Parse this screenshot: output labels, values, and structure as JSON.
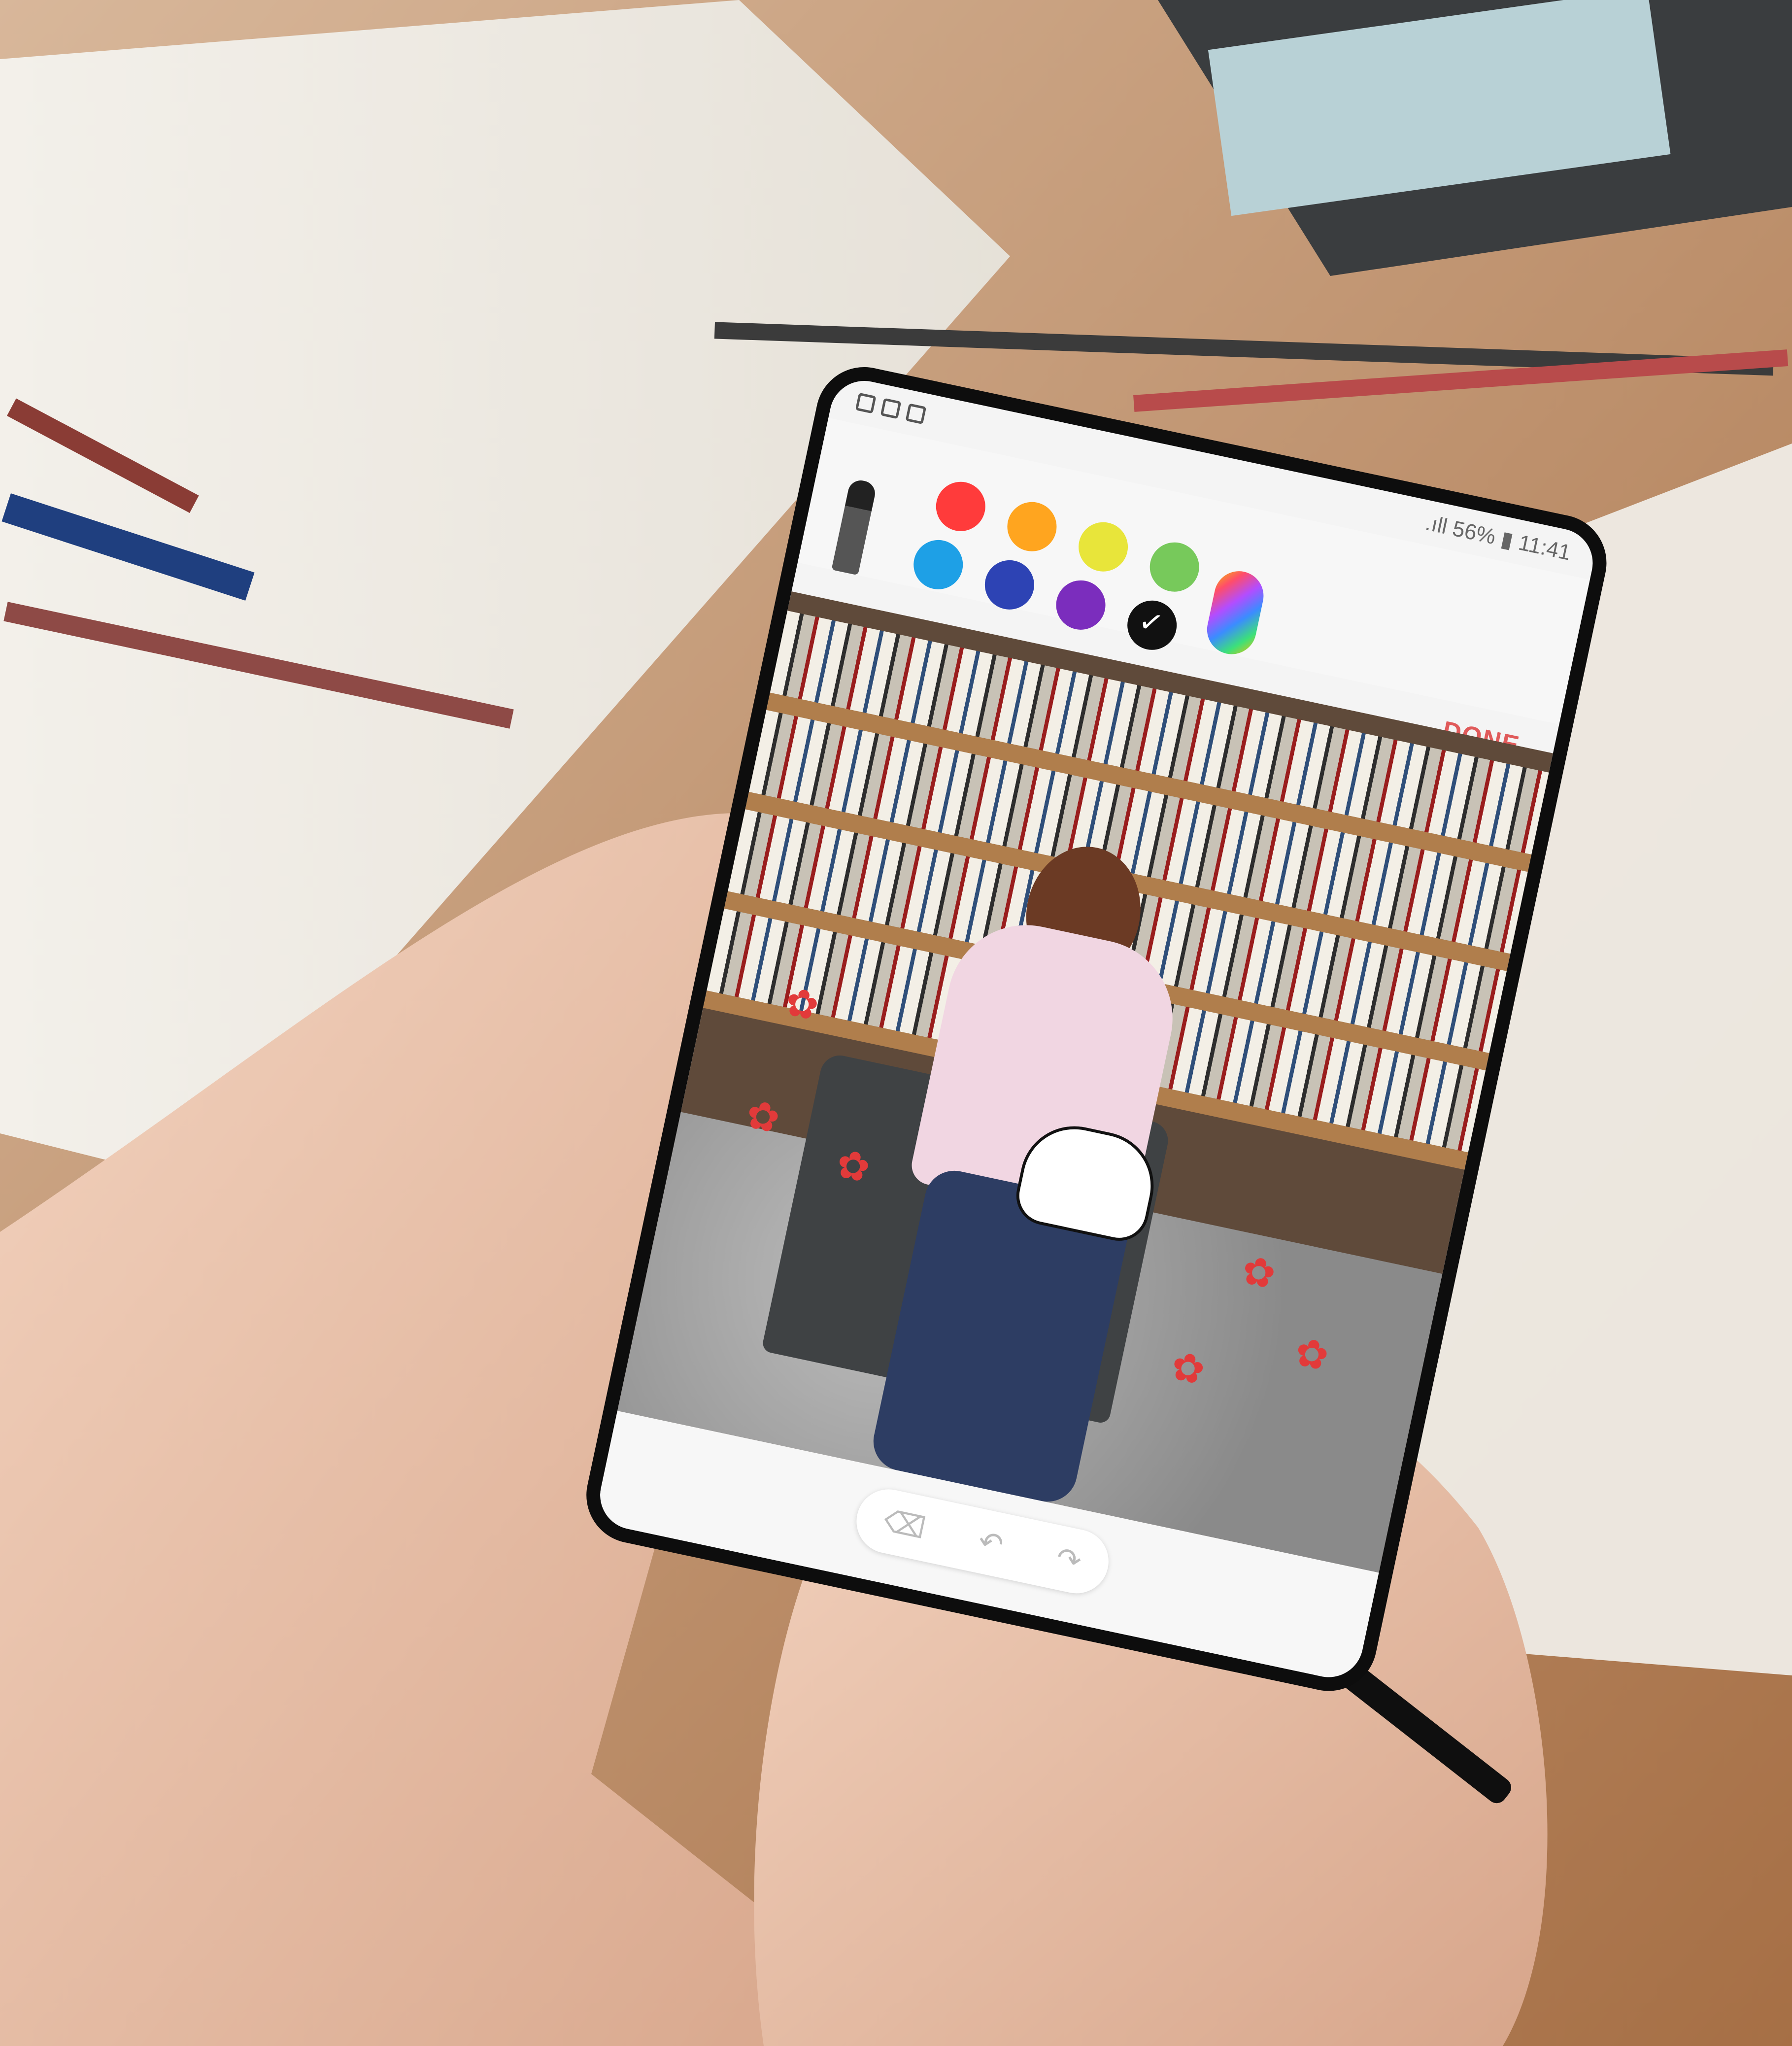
{
  "status_bar": {
    "signal": ".ıll",
    "battery": "56%",
    "time": "11:41",
    "notification_icons": [
      "gallery-notification-icon",
      "gallery-notification-icon",
      "sd-card-icon"
    ]
  },
  "toolbar": {
    "done_label": "DONE"
  },
  "palette": {
    "selected_color": "#111111",
    "colors": [
      "#ff3b3b",
      "#ffa51f",
      "#e8e53a",
      "#77c95b",
      "#1ea0e6",
      "#2d43b4",
      "#7b2dbd",
      "#111111"
    ]
  },
  "edit_controls": {
    "icons": [
      "eraser-icon",
      "undo-icon",
      "redo-icon"
    ]
  }
}
